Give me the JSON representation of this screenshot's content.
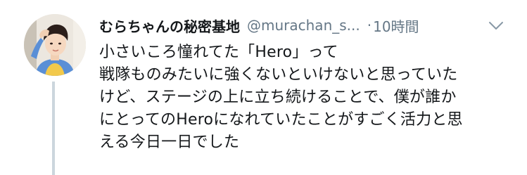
{
  "tweet": {
    "display_name": "むらちゃんの秘密基地",
    "handle": "@murachan_s...",
    "separator": "·",
    "time": "10時間",
    "lines": [
      "小さいころ憧れてた「Hero」って",
      "戦隊ものみたいに強くないといけないと思っていた",
      "けど、ステージの上に立ち続けることで、僕が誰か",
      "にとってのHeroになれていたことがすごく活力と思",
      "える今日一日でした"
    ]
  },
  "colors": {
    "text_primary": "#14171a",
    "text_secondary": "#657786",
    "thread_line": "#ccd6dd",
    "background": "#ffffff"
  },
  "icons": {
    "menu": "chevron-down-icon"
  }
}
